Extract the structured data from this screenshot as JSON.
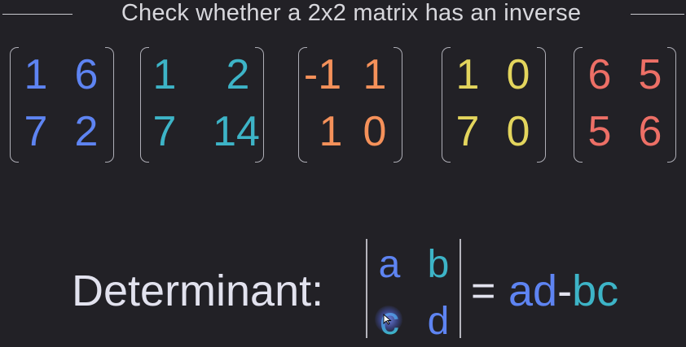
{
  "title": "Check whether a 2x2 matrix has an inverse",
  "colors": {
    "background": "#222126",
    "blue": "#5e84f2",
    "teal": "#3db4c7",
    "orange": "#f5915a",
    "yellow": "#e3d55d",
    "red": "#ed6f66",
    "text": "#e2e2ee"
  },
  "matrices": [
    {
      "color": "#5e84f2",
      "a": "1",
      "b": "6",
      "c": "7",
      "d": "2"
    },
    {
      "color": "#3db4c7",
      "a": "1",
      "b": "2",
      "c": "7",
      "d": "14"
    },
    {
      "color": "#f5915a",
      "a": "-1",
      "b": "1",
      "c": "1",
      "d": "0"
    },
    {
      "color": "#e3d55d",
      "a": "1",
      "b": "0",
      "c": "7",
      "d": "0"
    },
    {
      "color": "#ed6f66",
      "a": "6",
      "b": "5",
      "c": "5",
      "d": "6"
    }
  ],
  "determinant": {
    "label": "Determinant:",
    "cells": {
      "a": "a",
      "b": "b",
      "c": "c",
      "d": "d"
    },
    "equals": "=",
    "formula": {
      "ad": "ad",
      "minus": "-",
      "bc": "bc"
    }
  },
  "pointer_icon": "mouse-pointer-icon"
}
